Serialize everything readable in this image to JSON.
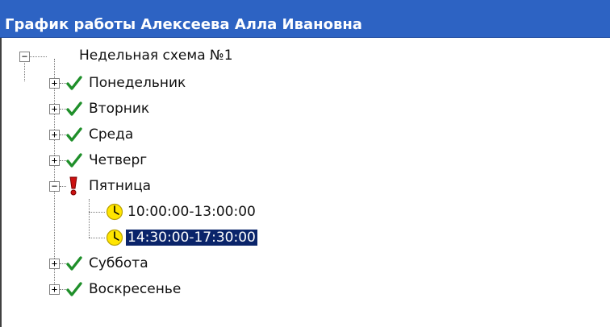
{
  "window": {
    "title": "График работы Алексеева Алла Ивановна"
  },
  "tree": {
    "root": {
      "label": "Недельная схема №1",
      "expander": "−"
    },
    "days": [
      {
        "label": "Понедельник",
        "expander": "+",
        "status_icon": "check-icon"
      },
      {
        "label": "Вторник",
        "expander": "+",
        "status_icon": "check-icon"
      },
      {
        "label": "Среда",
        "expander": "+",
        "status_icon": "check-icon"
      },
      {
        "label": "Четверг",
        "expander": "+",
        "status_icon": "check-icon"
      },
      {
        "label": "Пятница",
        "expander": "−",
        "status_icon": "exclamation-icon",
        "intervals": [
          {
            "label": "10:00:00-13:00:00",
            "icon": "clock-icon",
            "selected": false
          },
          {
            "label": "14:30:00-17:30:00",
            "icon": "clock-icon",
            "selected": true
          }
        ]
      },
      {
        "label": "Суббота",
        "expander": "+",
        "status_icon": "check-icon"
      },
      {
        "label": "Воскресенье",
        "expander": "+",
        "status_icon": "check-icon"
      }
    ]
  },
  "colors": {
    "titlebar": "#2d63c3",
    "check": "#1f8f2a",
    "exclamation": "#cc1111",
    "clock": "#ffe500",
    "selection": "#0a246a"
  }
}
